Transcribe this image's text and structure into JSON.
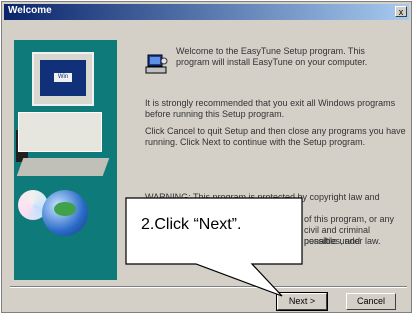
{
  "window": {
    "title": "Welcome",
    "close_label": "x"
  },
  "welcome_text": "Welcome to the EasyTune Setup program. This program will install EasyTune on your computer.",
  "paragraphs": [
    "It is strongly recommended that you exit all Windows programs before running this Setup program.",
    "Click Cancel to quit Setup and then close any programs you have running. Click Next to continue with the Setup program.",
    "WARNING: This program is protected by copyright law and international treaties."
  ],
  "warning_tail": [
    "of this program, or any",
    "civil and criminal penalties, and",
    "possible under law."
  ],
  "buttons": {
    "next": "Next >",
    "cancel": "Cancel"
  },
  "screen_label": "Win",
  "callout": "2.Click “Next”."
}
